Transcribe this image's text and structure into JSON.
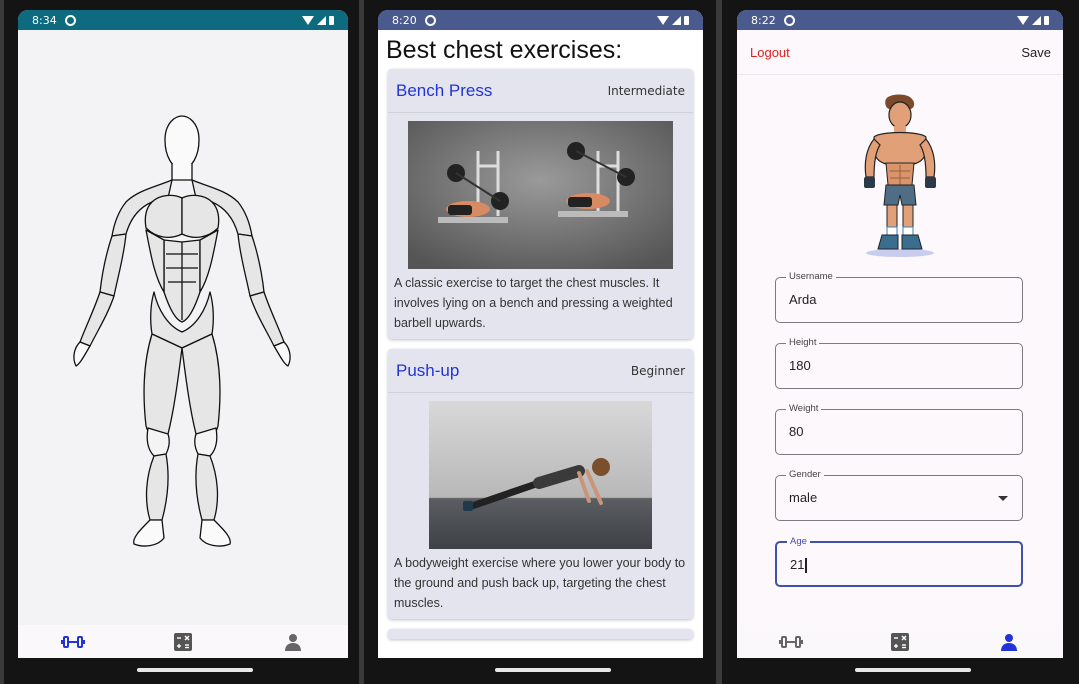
{
  "phones": [
    {
      "status": {
        "time": "8:34"
      },
      "nav": [
        "dumbbell-icon",
        "calculator-icon",
        "person-icon"
      ],
      "active_nav": 0
    },
    {
      "status": {
        "time": "8:20"
      },
      "heading": "Best chest exercises:",
      "exercises": [
        {
          "title": "Bench Press",
          "level": "Intermediate",
          "description": "A classic exercise to target the chest muscles. It involves lying on a bench and pressing a weighted barbell upwards."
        },
        {
          "title": "Push-up",
          "level": "Beginner",
          "description": "A bodyweight exercise where you lower your body to the ground and push back up, targeting the chest muscles."
        }
      ]
    },
    {
      "status": {
        "time": "8:22"
      },
      "topbar": {
        "logout": "Logout",
        "save": "Save"
      },
      "fields": [
        {
          "label": "Username",
          "value": "Arda"
        },
        {
          "label": "Height",
          "value": "180"
        },
        {
          "label": "Weight",
          "value": "80"
        },
        {
          "label": "Gender",
          "value": "male"
        },
        {
          "label": "Age",
          "value": "21"
        }
      ],
      "nav": [
        "dumbbell-icon",
        "calculator-icon",
        "person-icon"
      ],
      "active_nav": 2
    }
  ],
  "colors": {
    "accent_blue": "#2234d6",
    "logout_red": "#e02020",
    "status_teal": "#0e6b7f",
    "status_indigo": "#4a5a8c"
  }
}
